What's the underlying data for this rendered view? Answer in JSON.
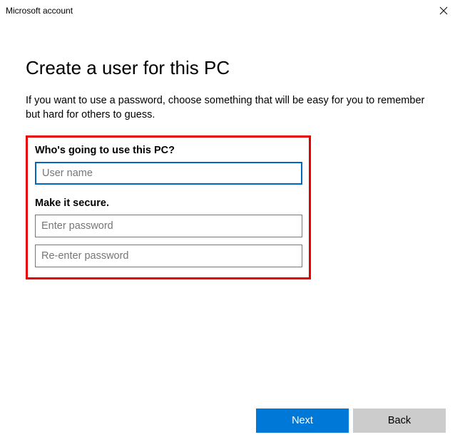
{
  "window": {
    "title": "Microsoft account"
  },
  "page": {
    "headline": "Create a user for this PC",
    "subtext": "If you want to use a password, choose something that will be easy for you to remember but hard for others to guess."
  },
  "form": {
    "section1_label": "Who's going to use this PC?",
    "username_placeholder": "User name",
    "username_value": "",
    "section2_label": "Make it secure.",
    "password_placeholder": "Enter password",
    "password_value": "",
    "confirm_placeholder": "Re-enter password",
    "confirm_value": ""
  },
  "buttons": {
    "next": "Next",
    "back": "Back"
  }
}
